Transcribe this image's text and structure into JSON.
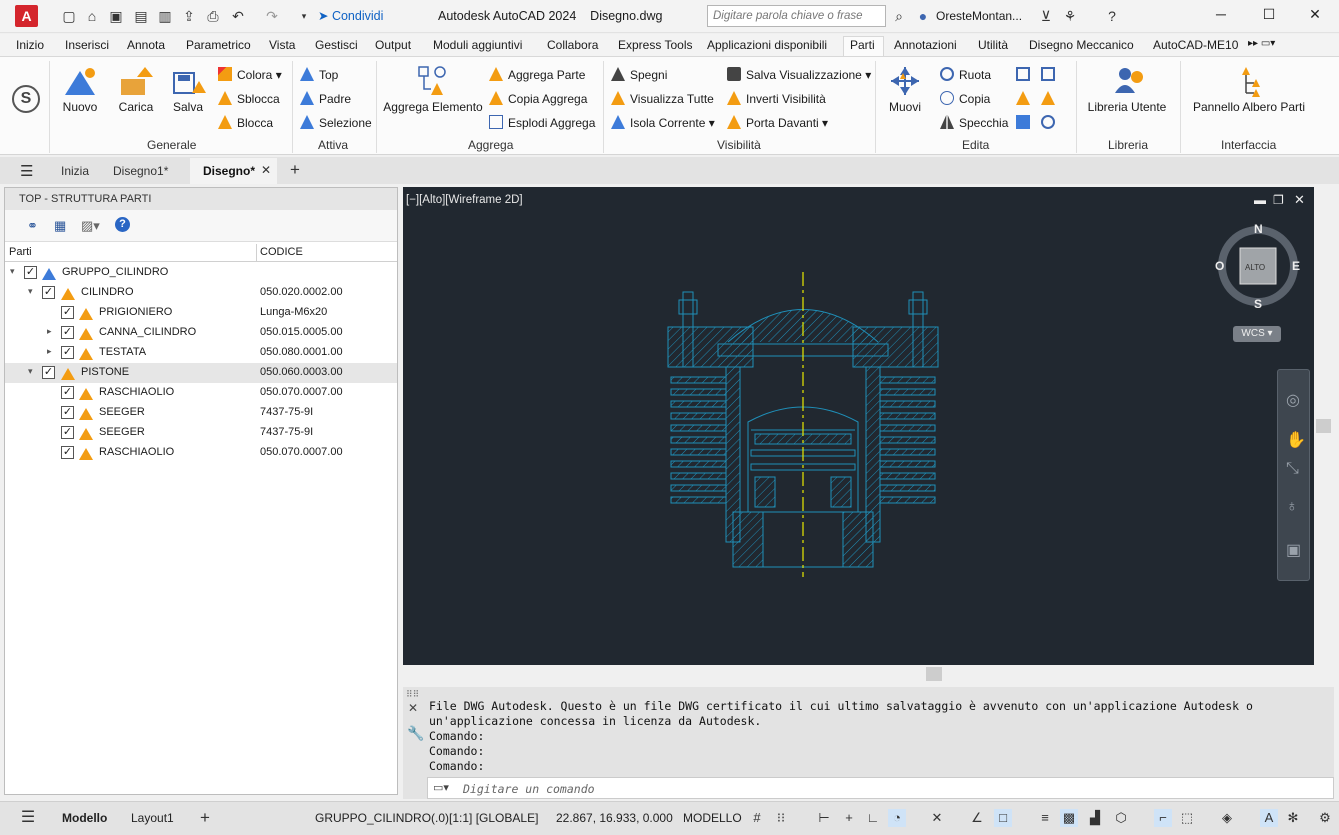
{
  "titlebar": {
    "logo": "A",
    "share_label": "Condividi",
    "title": "Autodesk AutoCAD 2024    Disegno.dwg",
    "search_placeholder": "Digitare parola chiave o frase",
    "user": "OresteMontan..."
  },
  "ribbon_tabs": [
    "Inizio",
    "Inserisci",
    "Annota",
    "Parametrico",
    "Vista",
    "Gestisci",
    "Output",
    "Moduli aggiuntivi",
    "Collabora",
    "Express Tools",
    "Applicazioni disponibili",
    "Parti",
    "Annotazioni",
    "Utilità",
    "Disegno Meccanico",
    "AutoCAD-ME10"
  ],
  "active_ribbon_tab": "Parti",
  "ribbon": {
    "generale": {
      "label": "Generale",
      "nuovo": "Nuovo",
      "carica": "Carica",
      "salva": "Salva",
      "colora": "Colora",
      "sblocca": "Sblocca",
      "blocca": "Blocca"
    },
    "attiva": {
      "label": "Attiva",
      "top": "Top",
      "padre": "Padre",
      "selezione": "Selezione"
    },
    "aggrega": {
      "label": "Aggrega",
      "aggrega_elemento": "Aggrega Elemento",
      "aggrega_parte": "Aggrega Parte",
      "copia_aggrega": "Copia Aggrega",
      "esplodi_aggrega": "Esplodi Aggrega"
    },
    "visibilita": {
      "label": "Visibilità",
      "spegni": "Spegni",
      "visualizza_tutte": "Visualizza Tutte",
      "isola_corrente": "Isola Corrente",
      "salva_visualizzazione": "Salva Visualizzazione",
      "inverti_visibilita": "Inverti Visibilità",
      "porta_davanti": "Porta Davanti"
    },
    "edita": {
      "label": "Edita",
      "muovi": "Muovi",
      "ruota": "Ruota",
      "copia": "Copia",
      "specchia": "Specchia"
    },
    "libreria": {
      "label": "Libreria",
      "libreria_utente": "Libreria Utente"
    },
    "interfaccia": {
      "label": "Interfaccia",
      "pannello_albero_parti": "Pannello Albero Parti"
    }
  },
  "file_tabs": {
    "start": "Inizia",
    "disegno1": "Disegno1*",
    "disegno": "Disegno*"
  },
  "parts_panel": {
    "title": "TOP - STRUTTURA PARTI",
    "col_parts": "Parti",
    "col_code": "CODICE",
    "rows": [
      {
        "name": "GRUPPO_CILINDRO",
        "code": ""
      },
      {
        "name": "CILINDRO",
        "code": "050.020.0002.00"
      },
      {
        "name": "PRIGIONIERO",
        "code": "Lunga-M6x20"
      },
      {
        "name": "CANNA_CILINDRO",
        "code": "050.015.0005.00"
      },
      {
        "name": "TESTATA",
        "code": "050.080.0001.00"
      },
      {
        "name": "PISTONE",
        "code": "050.060.0003.00"
      },
      {
        "name": "RASCHIAOLIO",
        "code": "050.070.0007.00"
      },
      {
        "name": "SEEGER",
        "code": "7437-75-9I"
      },
      {
        "name": "SEEGER",
        "code": "7437-75-9I"
      },
      {
        "name": "RASCHIAOLIO",
        "code": "050.070.0007.00"
      }
    ]
  },
  "viewport": {
    "label": "[−][Alto][Wireframe 2D]",
    "compass": {
      "n": "N",
      "s": "S",
      "e": "E",
      "w": "O",
      "cube": "ALTO",
      "ucs": "WCS"
    }
  },
  "command": {
    "history": "File DWG Autodesk. Questo è un file DWG certificato il cui ultimo salvataggio è avvenuto con un'applicazione Autodesk o\nun'applicazione concessa in licenza da Autodesk.\nComando:\nComando:\nComando:",
    "placeholder": "Digitare un comando"
  },
  "statusbar": {
    "model_tab": "Modello",
    "layout_tab": "Layout1",
    "current_part": "GRUPPO_CILINDRO(.0)[1:1] [GLOBALE]",
    "coords": "22.867, 16.933, 0.000",
    "mode": "MODELLO"
  },
  "colors": {
    "accent": "#0f62c4",
    "drawing_line": "#1f8fb8",
    "centerline": "#e8e800",
    "viewport_bg": "#212830",
    "part_icon": "#f39c12"
  }
}
